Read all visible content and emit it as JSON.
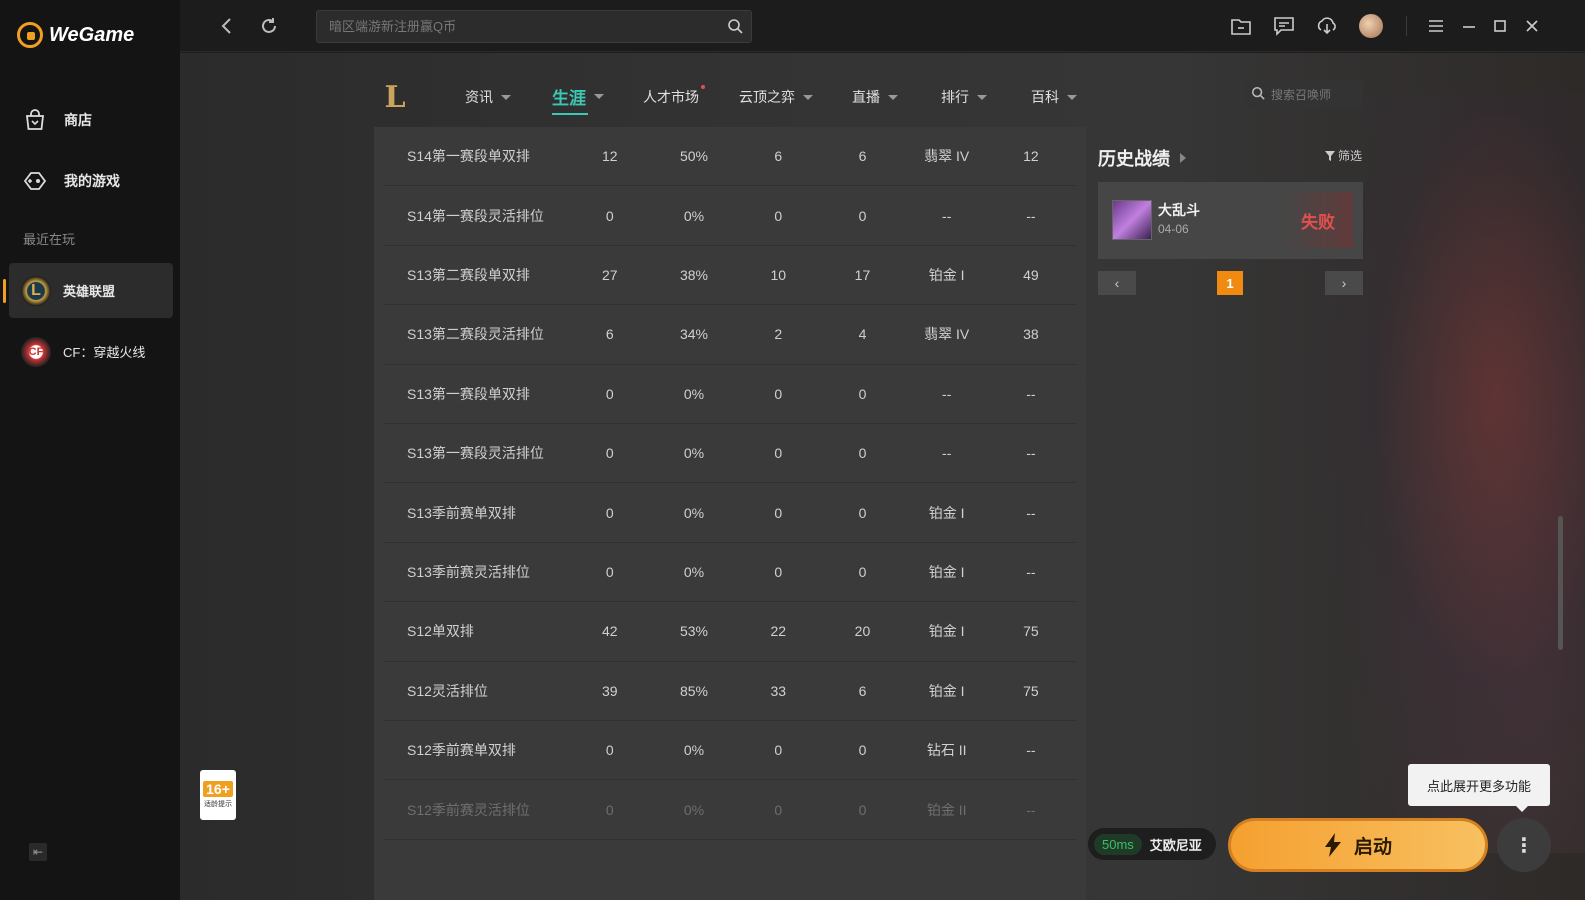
{
  "app": {
    "title": "WeGame"
  },
  "sidebar": {
    "nav": [
      {
        "label": "商店",
        "icon": "shop-bag-icon"
      },
      {
        "label": "我的游戏",
        "icon": "gamepad-icon"
      }
    ],
    "recent_label": "最近在玩",
    "games": [
      {
        "label": "英雄联盟",
        "icon": "league-of-legends-icon",
        "active": true
      },
      {
        "label": "CF：穿越火线",
        "icon": "crossfire-icon",
        "active": false
      }
    ],
    "age_rating": {
      "value": "16+",
      "caption": "适龄提示"
    },
    "collapse_icon": "collapse-sidebar-icon"
  },
  "topbar": {
    "search_placeholder": "暗区端游新注册赢Q币",
    "icons": [
      "back-icon",
      "refresh-icon",
      "search-icon",
      "inbox-icon",
      "message-icon",
      "download-icon",
      "avatar",
      "menu-icon",
      "minimize-icon",
      "maximize-icon",
      "close-icon"
    ]
  },
  "game_nav": {
    "logo": "L",
    "tabs": [
      {
        "label": "资讯",
        "has_caret": true
      },
      {
        "label": "生涯",
        "has_caret": true,
        "active": true
      },
      {
        "label": "人才市场",
        "has_dot": true
      },
      {
        "label": "云顶之弈",
        "has_caret": true
      },
      {
        "label": "直播",
        "has_caret": true
      },
      {
        "label": "排行",
        "has_caret": true
      },
      {
        "label": "百科",
        "has_caret": true
      }
    ],
    "summoner_search_placeholder": "搜索召唤师"
  },
  "career_table": {
    "rows": [
      {
        "season": "S14第一赛段单双排",
        "total": "12",
        "winrate": "50%",
        "wins": "6",
        "losses": "6",
        "rank": "翡翠 IV",
        "lp": "12"
      },
      {
        "season": "S14第一赛段灵活排位",
        "total": "0",
        "winrate": "0%",
        "wins": "0",
        "losses": "0",
        "rank": "--",
        "lp": "--"
      },
      {
        "season": "S13第二赛段单双排",
        "total": "27",
        "winrate": "38%",
        "wins": "10",
        "losses": "17",
        "rank": "铂金 I",
        "lp": "49"
      },
      {
        "season": "S13第二赛段灵活排位",
        "total": "6",
        "winrate": "34%",
        "wins": "2",
        "losses": "4",
        "rank": "翡翠 IV",
        "lp": "38"
      },
      {
        "season": "S13第一赛段单双排",
        "total": "0",
        "winrate": "0%",
        "wins": "0",
        "losses": "0",
        "rank": "--",
        "lp": "--"
      },
      {
        "season": "S13第一赛段灵活排位",
        "total": "0",
        "winrate": "0%",
        "wins": "0",
        "losses": "0",
        "rank": "--",
        "lp": "--"
      },
      {
        "season": "S13季前赛单双排",
        "total": "0",
        "winrate": "0%",
        "wins": "0",
        "losses": "0",
        "rank": "铂金 I",
        "lp": "--"
      },
      {
        "season": "S13季前赛灵活排位",
        "total": "0",
        "winrate": "0%",
        "wins": "0",
        "losses": "0",
        "rank": "铂金 I",
        "lp": "--"
      },
      {
        "season": "S12单双排",
        "total": "42",
        "winrate": "53%",
        "wins": "22",
        "losses": "20",
        "rank": "铂金 I",
        "lp": "75"
      },
      {
        "season": "S12灵活排位",
        "total": "39",
        "winrate": "85%",
        "wins": "33",
        "losses": "6",
        "rank": "铂金 I",
        "lp": "75"
      },
      {
        "season": "S12季前赛单双排",
        "total": "0",
        "winrate": "0%",
        "wins": "0",
        "losses": "0",
        "rank": "钻石 II",
        "lp": "--"
      },
      {
        "season": "S12季前赛灵活排位",
        "total": "0",
        "winrate": "0%",
        "wins": "0",
        "losses": "0",
        "rank": "铂金 II",
        "lp": "--"
      }
    ]
  },
  "history": {
    "title": "历史战绩",
    "filter_label": "筛选",
    "matches": [
      {
        "mode": "大乱斗",
        "date": "04-06",
        "result": "失败"
      }
    ],
    "page": "1",
    "prev": "‹",
    "next": "›"
  },
  "bottom": {
    "ping": "50ms",
    "server": "艾欧尼亚",
    "launch_label": "启动",
    "tooltip": "点此展开更多功能",
    "more_icon": "more-vertical-icon"
  }
}
